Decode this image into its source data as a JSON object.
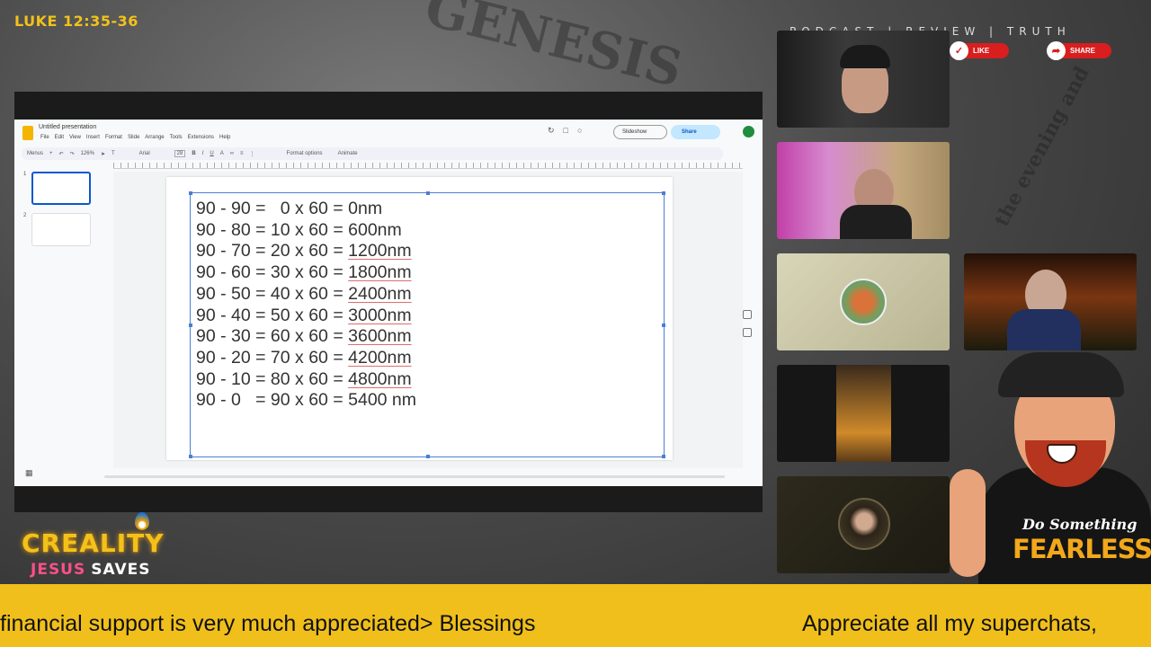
{
  "overlay": {
    "scripture_ref": "LUKE 12:35-36",
    "banner": "PODCAST | REVIEW | TRUTH",
    "like_label": "LIKE",
    "share_label": "SHARE",
    "logo_title": "CREALITY",
    "logo_sub_a": "JESUS",
    "logo_sub_b": "SAVES",
    "shirt_line1": "Do Something",
    "shirt_line2": "FEARLESS"
  },
  "ticker": {
    "segment_a": "financial support is very much appreciated> Blessings",
    "segment_b": "Appreciate all my superchats,"
  },
  "slides_app": {
    "doc_title": "Untitled presentation",
    "menus": [
      "File",
      "Edit",
      "View",
      "Insert",
      "Format",
      "Slide",
      "Arrange",
      "Tools",
      "Extensions",
      "Help"
    ],
    "slideshow_label": "Slideshow",
    "share_label": "Share",
    "toolbar": {
      "search": "Menus",
      "zoom": "126%",
      "font": "Arial",
      "font_size": "28",
      "format_options": "Format options",
      "animate": "Animate"
    },
    "thumbnails": [
      {
        "number": "1",
        "selected": true
      },
      {
        "number": "2",
        "selected": false
      }
    ],
    "slide_lines": [
      {
        "left": "90 - 90 =   0 x 60 = ",
        "right": "0nm",
        "underline": false
      },
      {
        "left": "90 - 80 = 10 x 60 = ",
        "right": "600nm",
        "underline": false
      },
      {
        "left": "90 - 70 = 20 x 60 = ",
        "right": "1200nm",
        "underline": true
      },
      {
        "left": "90 - 60 = 30 x 60 = ",
        "right": "1800nm",
        "underline": true
      },
      {
        "left": "90 - 50 = 40 x 60 = ",
        "right": "2400nm",
        "underline": true
      },
      {
        "left": "90 - 40 = 50 x 60 = ",
        "right": "3000nm",
        "underline": true
      },
      {
        "left": "90 - 30 = 60 x 60 = ",
        "right": "3600nm",
        "underline": true
      },
      {
        "left": "90 - 20 = 70 x 60 = ",
        "right": "4200nm",
        "underline": true
      },
      {
        "left": "90 - 10 = 80 x 60 = ",
        "right": "4800nm",
        "underline": true
      },
      {
        "left": "90 - 0   = 90 x 60 = ",
        "right": "5400 nm",
        "underline": false
      }
    ]
  },
  "colors": {
    "accent_yellow": "#f0bf1b",
    "brand_pink": "#ff4f8b",
    "like_red": "#d81e1e",
    "selection_blue": "#4a7fd0"
  }
}
